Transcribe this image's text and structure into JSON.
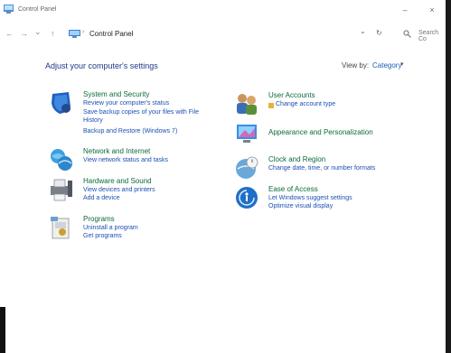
{
  "window": {
    "title": "Control Panel",
    "min_glyph": "–",
    "close_glyph": "×"
  },
  "addressbar": {
    "back_glyph": "←",
    "forward_glyph": "→",
    "dropdown_glyph": "⌄",
    "up_glyph": "↑",
    "separator": "›",
    "breadcrumb": "Control Panel",
    "history_glyph": "⌄",
    "refresh_glyph": "↻",
    "search_placeholder": "Search Co"
  },
  "main": {
    "heading": "Adjust your computer's settings",
    "view_by_label": "View by:",
    "view_by_value": "Category",
    "view_by_caret": "▾"
  },
  "categories_left": [
    {
      "title": "System and Security",
      "icon": "shield-icon",
      "links": [
        "Review your computer's status",
        "Save backup copies of your files with File History",
        "Backup and Restore (Windows 7)"
      ]
    },
    {
      "title": "Network and Internet",
      "icon": "network-globe-icon",
      "links": [
        "View network status and tasks"
      ]
    },
    {
      "title": "Hardware and Sound",
      "icon": "printer-icon",
      "links": [
        "View devices and printers",
        "Add a device"
      ]
    },
    {
      "title": "Programs",
      "icon": "programs-icon",
      "links": [
        "Uninstall a program",
        "Get programs"
      ]
    }
  ],
  "categories_right": [
    {
      "title": "User Accounts",
      "icon": "users-icon",
      "links": [
        "Change account type"
      ]
    },
    {
      "title": "Appearance and Personalization",
      "icon": "appearance-icon",
      "links": []
    },
    {
      "title": "Clock and Region",
      "icon": "clock-globe-icon",
      "links": [
        "Change date, time, or number formats"
      ]
    },
    {
      "title": "Ease of Access",
      "icon": "ease-of-access-icon",
      "links": [
        "Let Windows suggest settings",
        "Optimize visual display"
      ]
    }
  ],
  "colors": {
    "heading": "#1f3a88",
    "category_title": "#0b6b3a",
    "link": "#1a4fb4"
  }
}
